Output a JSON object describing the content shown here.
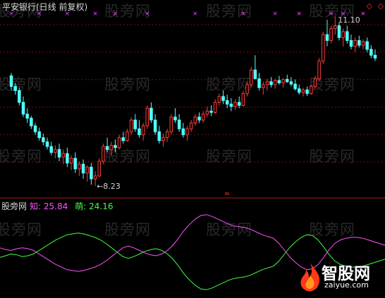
{
  "title": "平安银行(日线 前复权)",
  "watermark": "股旁网",
  "logo": {
    "text": "智股网",
    "url": "zaiyue.com",
    "icon": "flame-icon"
  },
  "indicator": {
    "name": "股旁网",
    "line1": {
      "label": "知",
      "value": "25.84",
      "color": "#ff50ff"
    },
    "line2": {
      "label": "萌",
      "value": "24.16",
      "color": "#40ff40"
    }
  },
  "markers": {
    "diamond": "◇"
  },
  "chart_data": [
    {
      "type": "candlestick",
      "title": "平安银行(日线 前复权)",
      "annotations": [
        {
          "label": "←8.23",
          "kind": "low"
        },
        {
          "label": "11.10",
          "kind": "high"
        }
      ],
      "colors": {
        "up": "#ff3c3c",
        "down": "#54ffff"
      },
      "ohlc": [
        [
          10.1,
          10.15,
          9.85,
          9.92
        ],
        [
          9.92,
          9.98,
          9.78,
          9.85
        ],
        [
          9.85,
          9.9,
          9.6,
          9.65
        ],
        [
          9.65,
          9.75,
          9.4,
          9.45
        ],
        [
          9.45,
          9.55,
          9.3,
          9.38
        ],
        [
          9.38,
          9.42,
          9.2,
          9.25
        ],
        [
          9.25,
          9.3,
          9.1,
          9.15
        ],
        [
          9.15,
          9.22,
          9.0,
          9.05
        ],
        [
          9.05,
          9.12,
          8.92,
          8.98
        ],
        [
          8.98,
          9.05,
          8.85,
          8.9
        ],
        [
          8.9,
          8.98,
          8.75,
          8.8
        ],
        [
          8.8,
          8.92,
          8.7,
          8.85
        ],
        [
          8.85,
          8.95,
          8.65,
          8.72
        ],
        [
          8.72,
          8.85,
          8.6,
          8.78
        ],
        [
          8.78,
          8.88,
          8.55,
          8.62
        ],
        [
          8.62,
          8.75,
          8.5,
          8.7
        ],
        [
          8.7,
          8.8,
          8.45,
          8.52
        ],
        [
          8.52,
          8.65,
          8.4,
          8.6
        ],
        [
          8.6,
          8.68,
          8.35,
          8.45
        ],
        [
          8.45,
          8.58,
          8.3,
          8.55
        ],
        [
          8.55,
          8.62,
          8.25,
          8.35
        ],
        [
          8.35,
          8.48,
          8.23,
          8.4
        ],
        [
          8.4,
          8.7,
          8.38,
          8.65
        ],
        [
          8.65,
          8.95,
          8.6,
          8.9
        ],
        [
          8.9,
          9.05,
          8.8,
          8.85
        ],
        [
          8.85,
          8.98,
          8.75,
          8.92
        ],
        [
          8.92,
          9.02,
          8.8,
          8.88
        ],
        [
          8.88,
          9.1,
          8.85,
          9.05
        ],
        [
          9.05,
          9.15,
          8.95,
          9.0
        ],
        [
          9.0,
          9.2,
          8.98,
          9.15
        ],
        [
          9.15,
          9.4,
          9.1,
          9.35
        ],
        [
          9.35,
          9.45,
          9.15,
          9.2
        ],
        [
          9.2,
          9.35,
          9.05,
          9.1
        ],
        [
          9.1,
          9.3,
          9.0,
          9.25
        ],
        [
          9.25,
          9.6,
          9.2,
          9.55
        ],
        [
          9.55,
          9.65,
          9.3,
          9.35
        ],
        [
          9.35,
          9.45,
          9.1,
          9.15
        ],
        [
          9.15,
          9.25,
          8.95,
          9.0
        ],
        [
          9.0,
          9.12,
          8.9,
          9.05
        ],
        [
          9.05,
          9.2,
          8.98,
          9.15
        ],
        [
          9.15,
          9.45,
          9.1,
          9.4
        ],
        [
          9.4,
          9.55,
          9.3,
          9.35
        ],
        [
          9.35,
          9.45,
          9.15,
          9.2
        ],
        [
          9.2,
          9.3,
          9.05,
          9.1
        ],
        [
          9.1,
          9.25,
          9.0,
          9.2
        ],
        [
          9.2,
          9.35,
          9.15,
          9.3
        ],
        [
          9.3,
          9.45,
          9.25,
          9.4
        ],
        [
          9.4,
          9.48,
          9.3,
          9.35
        ],
        [
          9.35,
          9.5,
          9.3,
          9.45
        ],
        [
          9.45,
          9.58,
          9.4,
          9.5
        ],
        [
          9.5,
          9.6,
          9.42,
          9.48
        ],
        [
          9.48,
          9.7,
          9.45,
          9.65
        ],
        [
          9.65,
          9.8,
          9.6,
          9.75
        ],
        [
          9.75,
          9.85,
          9.62,
          9.68
        ],
        [
          9.68,
          9.78,
          9.55,
          9.62
        ],
        [
          9.62,
          9.72,
          9.5,
          9.58
        ],
        [
          9.58,
          9.7,
          9.52,
          9.65
        ],
        [
          9.65,
          9.75,
          9.55,
          9.6
        ],
        [
          9.6,
          9.85,
          9.58,
          9.8
        ],
        [
          9.8,
          10.0,
          9.75,
          9.95
        ],
        [
          9.95,
          10.25,
          9.9,
          10.2
        ],
        [
          10.2,
          10.45,
          10.15,
          10.05
        ],
        [
          10.05,
          10.15,
          9.85,
          9.9
        ],
        [
          9.9,
          10.0,
          9.78,
          9.95
        ],
        [
          9.95,
          10.05,
          9.85,
          10.0
        ],
        [
          10.0,
          10.08,
          9.9,
          9.95
        ],
        [
          9.95,
          10.05,
          9.88,
          10.02
        ],
        [
          10.02,
          10.1,
          9.95,
          9.98
        ],
        [
          9.98,
          10.06,
          9.9,
          10.04
        ],
        [
          10.04,
          10.12,
          9.98,
          10.0
        ],
        [
          10.0,
          10.08,
          9.92,
          9.96
        ],
        [
          9.96,
          10.04,
          9.85,
          9.88
        ],
        [
          9.88,
          9.95,
          9.78,
          9.82
        ],
        [
          9.82,
          9.9,
          9.75,
          9.86
        ],
        [
          9.86,
          9.92,
          9.76,
          9.8
        ],
        [
          9.8,
          9.95,
          9.78,
          9.92
        ],
        [
          9.92,
          10.1,
          9.88,
          10.05
        ],
        [
          10.05,
          10.4,
          10.0,
          10.35
        ],
        [
          10.35,
          10.85,
          10.3,
          10.8
        ],
        [
          10.8,
          11.05,
          10.6,
          10.7
        ],
        [
          10.7,
          10.95,
          10.65,
          10.9
        ],
        [
          10.9,
          11.1,
          10.8,
          10.95
        ],
        [
          10.95,
          11.0,
          10.7,
          10.75
        ],
        [
          10.75,
          10.9,
          10.6,
          10.85
        ],
        [
          10.85,
          10.95,
          10.65,
          10.7
        ],
        [
          10.7,
          10.8,
          10.55,
          10.6
        ],
        [
          10.6,
          10.75,
          10.5,
          10.7
        ],
        [
          10.7,
          10.78,
          10.58,
          10.62
        ],
        [
          10.62,
          10.72,
          10.55,
          10.68
        ],
        [
          10.68,
          10.75,
          10.5,
          10.55
        ],
        [
          10.55,
          10.62,
          10.4,
          10.45
        ],
        [
          10.45,
          10.55,
          10.35,
          10.4
        ]
      ]
    },
    {
      "type": "line",
      "series": [
        {
          "name": "知",
          "color": "#ff50ff",
          "ylim": [
            0,
            100
          ],
          "values": [
            55,
            53,
            52,
            54,
            55,
            54,
            52,
            48,
            44,
            40,
            36,
            33,
            30,
            29,
            28,
            29,
            31,
            33,
            36,
            40,
            45,
            50,
            55,
            57,
            55,
            52,
            49,
            47,
            46,
            48,
            52,
            58,
            66,
            75,
            82,
            88,
            92,
            93,
            91,
            88,
            85,
            82,
            80,
            79,
            78,
            76,
            73,
            70,
            68,
            66,
            60,
            52,
            44,
            38,
            33,
            30,
            31,
            36,
            44,
            53,
            60,
            64,
            66,
            67,
            67,
            66,
            64,
            62,
            60,
            58
          ]
        },
        {
          "name": "萌",
          "color": "#40ff40",
          "ylim": [
            0,
            100
          ],
          "values": [
            44,
            46,
            48,
            47,
            45,
            46,
            48,
            52,
            56,
            60,
            64,
            67,
            70,
            71,
            72,
            71,
            69,
            67,
            64,
            60,
            55,
            50,
            45,
            43,
            45,
            48,
            51,
            53,
            54,
            52,
            48,
            42,
            34,
            25,
            18,
            12,
            8,
            7,
            9,
            12,
            15,
            18,
            20,
            21,
            22,
            24,
            27,
            30,
            32,
            34,
            40,
            48,
            56,
            62,
            67,
            70,
            69,
            64,
            56,
            47,
            40,
            36,
            34,
            33,
            33,
            34,
            36,
            38,
            40,
            42
          ]
        }
      ]
    }
  ]
}
